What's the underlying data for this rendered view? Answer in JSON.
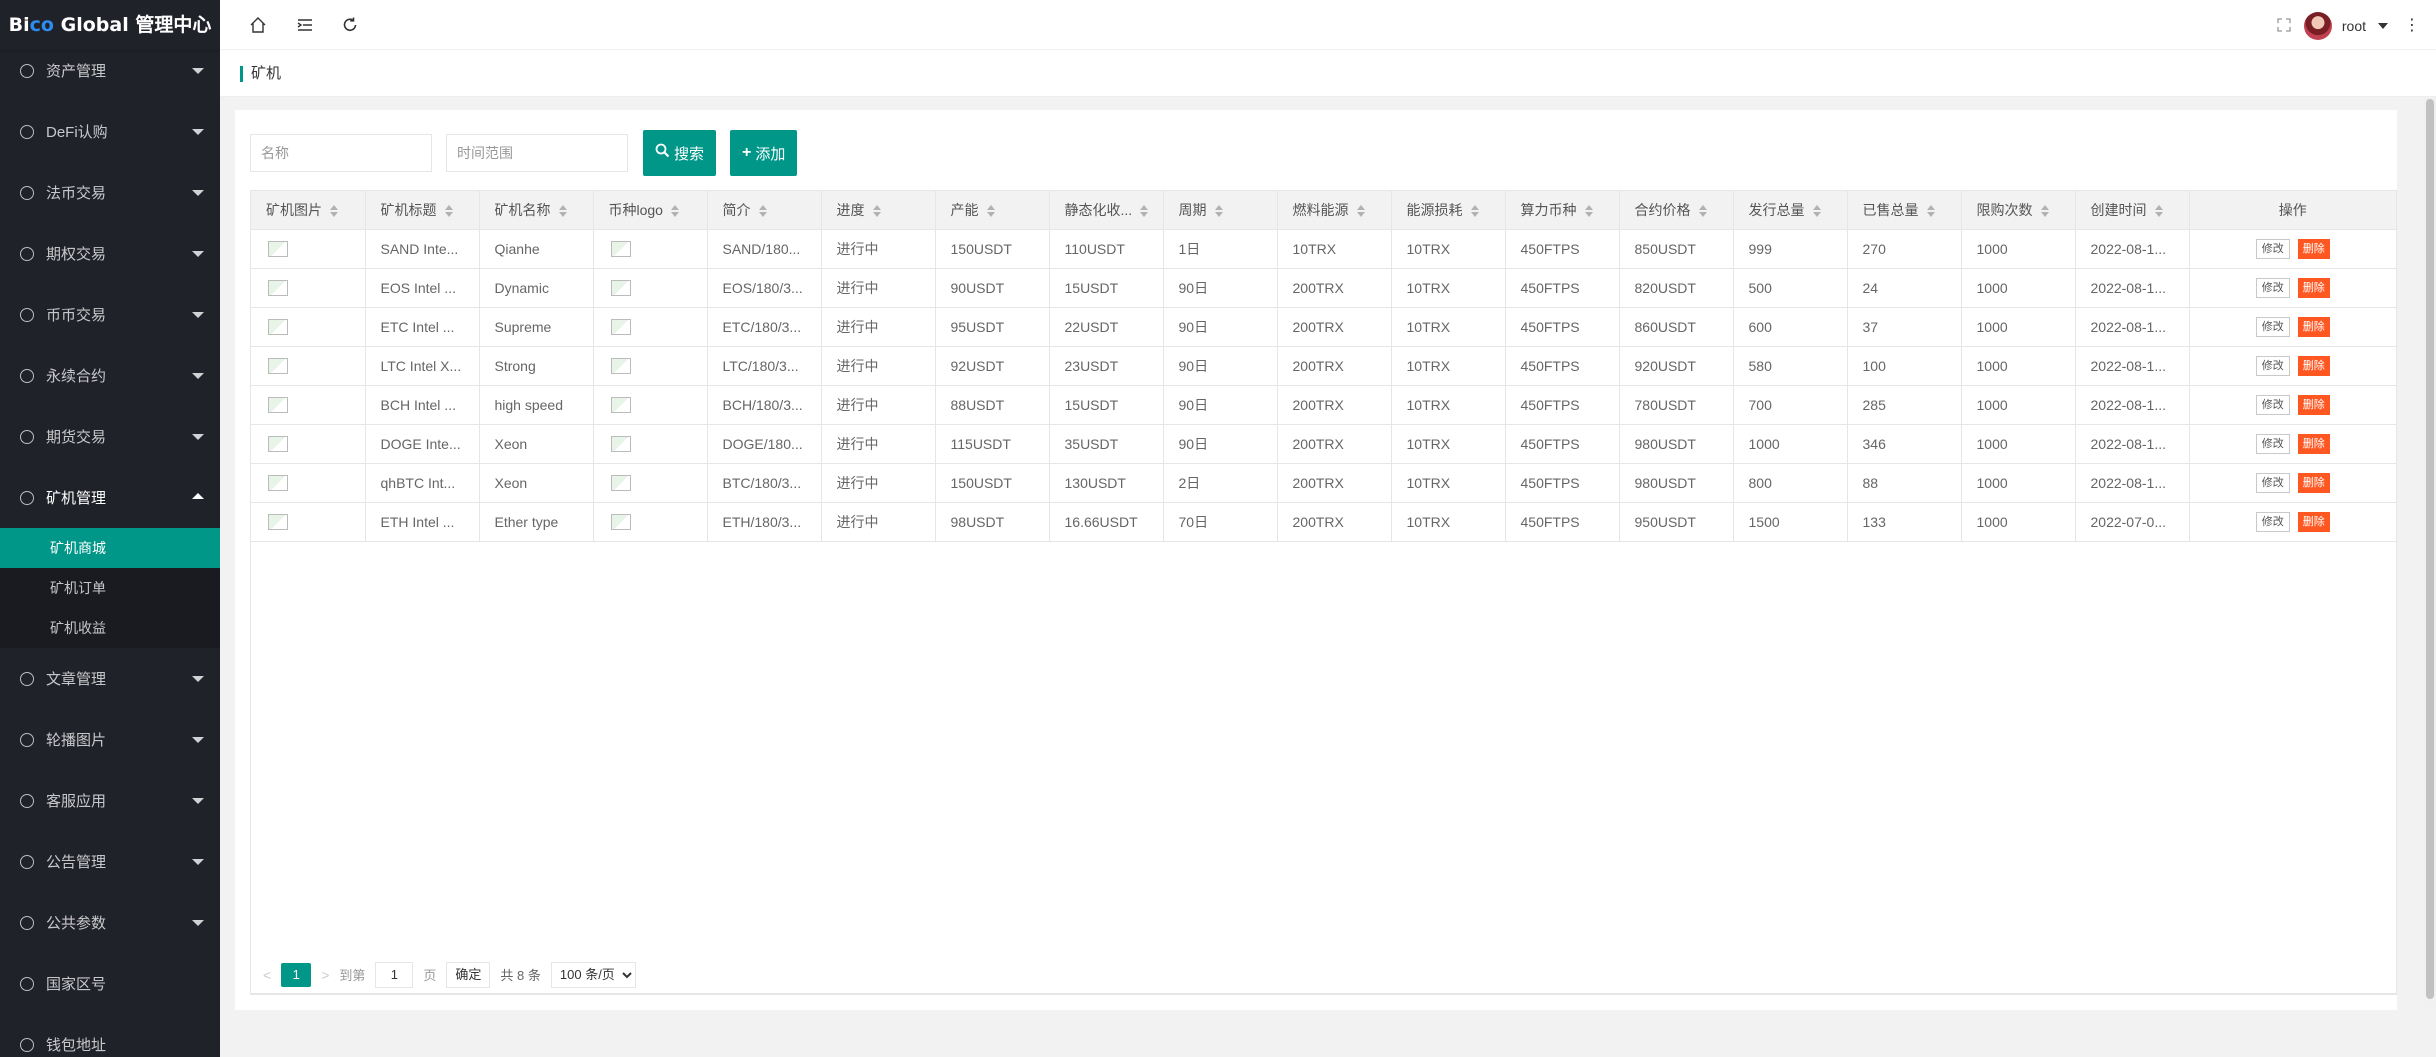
{
  "app_title_pre": "Bi",
  "app_title_acc": "co",
  "app_title_post": " Global 管理中心",
  "colors": {
    "accent": "#009688",
    "danger": "#ff5722",
    "sidebar_bg": "#20222a"
  },
  "sidebar": {
    "items": [
      {
        "label": "资产管理",
        "icon": "dollar-icon"
      },
      {
        "label": "DeFi认购",
        "icon": "clock-icon"
      },
      {
        "label": "法币交易",
        "icon": "fire-icon"
      },
      {
        "label": "期权交易",
        "icon": "star-icon"
      },
      {
        "label": "币币交易",
        "icon": "coin-icon"
      },
      {
        "label": "永续合约",
        "icon": "file-icon"
      },
      {
        "label": "期货交易",
        "icon": "diamond-icon"
      },
      {
        "label": "矿机管理",
        "icon": "euro-icon"
      }
    ],
    "submenu": [
      "矿机商城",
      "矿机订单",
      "矿机收益"
    ],
    "items_after": [
      {
        "label": "文章管理",
        "icon": "car-icon"
      },
      {
        "label": "轮播图片",
        "icon": "slides-icon"
      },
      {
        "label": "客服应用",
        "icon": "headset-icon"
      },
      {
        "label": "公告管理",
        "icon": "bell-icon"
      },
      {
        "label": "公共参数",
        "icon": "info-icon"
      },
      {
        "label": "国家区号",
        "icon": "phone-icon"
      },
      {
        "label": "钱包地址",
        "icon": "wallet-icon"
      }
    ]
  },
  "header": {
    "username": "root"
  },
  "breadcrumb": "矿机",
  "toolbar": {
    "name_placeholder": "名称",
    "time_placeholder": "时间范围",
    "search_label": "搜索",
    "add_label": "添加"
  },
  "table": {
    "columns": [
      "矿机图片",
      "矿机标题",
      "矿机名称",
      "币种logo",
      "简介",
      "进度",
      "产能",
      "静态化收...",
      "周期",
      "燃料能源",
      "能源损耗",
      "算力币种",
      "合约价格",
      "发行总量",
      "已售总量",
      "限购次数",
      "创建时间",
      "操作"
    ],
    "rows": [
      [
        "SAND Inte...",
        "Qianhe",
        "SAND/180...",
        "进行中",
        "150USDT",
        "110USDT",
        "1日",
        "10TRX",
        "10TRX",
        "450FTPS",
        "850USDT",
        "999",
        "270",
        "1000",
        "2022-08-1..."
      ],
      [
        "EOS Intel ...",
        "Dynamic",
        "EOS/180/3...",
        "进行中",
        "90USDT",
        "15USDT",
        "90日",
        "200TRX",
        "10TRX",
        "450FTPS",
        "820USDT",
        "500",
        "24",
        "1000",
        "2022-08-1..."
      ],
      [
        "ETC Intel ...",
        "Supreme",
        "ETC/180/3...",
        "进行中",
        "95USDT",
        "22USDT",
        "90日",
        "200TRX",
        "10TRX",
        "450FTPS",
        "860USDT",
        "600",
        "37",
        "1000",
        "2022-08-1..."
      ],
      [
        "LTC Intel X...",
        "Strong",
        "LTC/180/3...",
        "进行中",
        "92USDT",
        "23USDT",
        "90日",
        "200TRX",
        "10TRX",
        "450FTPS",
        "920USDT",
        "580",
        "100",
        "1000",
        "2022-08-1..."
      ],
      [
        "BCH Intel ...",
        "high speed",
        "BCH/180/3...",
        "进行中",
        "88USDT",
        "15USDT",
        "90日",
        "200TRX",
        "10TRX",
        "450FTPS",
        "780USDT",
        "700",
        "285",
        "1000",
        "2022-08-1..."
      ],
      [
        "DOGE Inte...",
        "Xeon",
        "DOGE/180...",
        "进行中",
        "115USDT",
        "35USDT",
        "90日",
        "200TRX",
        "10TRX",
        "450FTPS",
        "980USDT",
        "1000",
        "346",
        "1000",
        "2022-08-1..."
      ],
      [
        "qhBTC Int...",
        "Xeon",
        "BTC/180/3...",
        "进行中",
        "150USDT",
        "130USDT",
        "2日",
        "200TRX",
        "10TRX",
        "450FTPS",
        "980USDT",
        "800",
        "88",
        "1000",
        "2022-08-1..."
      ],
      [
        "ETH Intel ...",
        "Ether type",
        "ETH/180/3...",
        "进行中",
        "98USDT",
        "16.66USDT",
        "70日",
        "200TRX",
        "10TRX",
        "450FTPS",
        "950USDT",
        "1500",
        "133",
        "1000",
        "2022-07-0..."
      ]
    ],
    "edit_label": "修改",
    "delete_label": "删除"
  },
  "pager": {
    "current": "1",
    "goto_label": "到第",
    "page_input": "1",
    "page_unit": "页",
    "confirm_label": "确定",
    "total_text": "共 8 条",
    "page_size": "100 条/页"
  }
}
